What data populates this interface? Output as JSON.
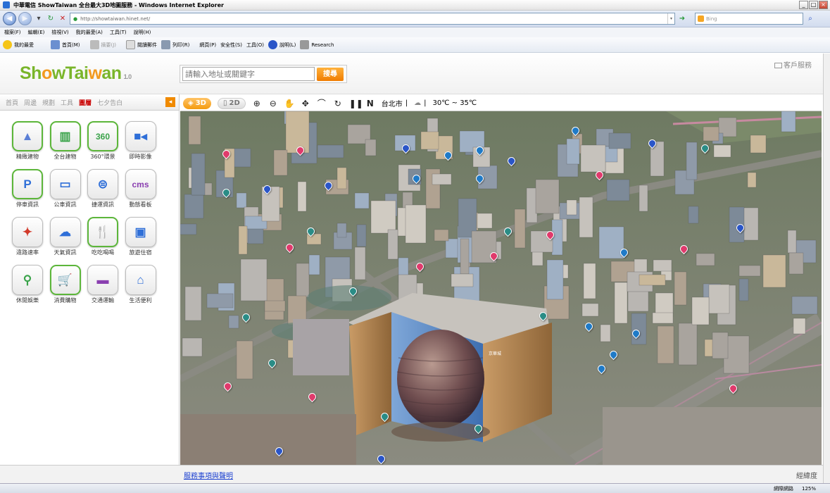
{
  "browser": {
    "title": "中華電信 ShowTaiwan 全台最大3D地圖服務 - Windows Internet Explorer",
    "url": "http://showtaiwan.hinet.net/",
    "bing_placeholder": "Bing",
    "menu": [
      "檔案(F)",
      "編輯(E)",
      "檢視(V)",
      "我的最愛(A)",
      "工具(T)",
      "說明(H)"
    ],
    "cmd": {
      "fav": "我的最愛",
      "home": "首頁(M)",
      "feed": "摘要(J)",
      "mail": "閱讀郵件",
      "print": "列印(R)",
      "page": "網頁(P)",
      "safety": "安全性(S)",
      "tools": "工具(O)",
      "help": "說明(L)",
      "research": "Research"
    },
    "status": {
      "zone": "網際網路",
      "zoom": "125%"
    }
  },
  "site": {
    "logo_a": "Sh",
    "logo_o": "o",
    "logo_b": "wTai",
    "logo_w": "w",
    "logo_c": "an",
    "version": "1.0",
    "search_placeholder": "請輸入地址或關鍵字",
    "search_button": "搜尋",
    "customer_service": "客戶服務"
  },
  "sidebar": {
    "tabs": [
      "首頁",
      "周邊",
      "規劃",
      "工具",
      "圖層",
      "七夕告白"
    ],
    "active_tab": "圖層",
    "arrow": "◂",
    "items": [
      {
        "label": "精緻建物",
        "icon": "tower-icon",
        "symbol": "▲",
        "color": "#5b7fd6",
        "highlight": true
      },
      {
        "label": "全台建物",
        "icon": "building-icon",
        "symbol": "▥",
        "color": "#3aa34a",
        "highlight": true
      },
      {
        "label": "360°環景",
        "icon": "panorama-360-icon",
        "symbol": "360",
        "color": "#3aa34a",
        "highlight": true
      },
      {
        "label": "即時影像",
        "icon": "video-camera-icon",
        "symbol": "■◂",
        "color": "#2f6fd8",
        "highlight": false
      },
      {
        "label": "停車資訊",
        "icon": "parking-icon",
        "symbol": "P",
        "color": "#2f6fd8",
        "highlight": true
      },
      {
        "label": "公車資訊",
        "icon": "bus-icon",
        "symbol": "▭",
        "color": "#2f6fd8",
        "highlight": false
      },
      {
        "label": "捷運資訊",
        "icon": "metro-icon",
        "symbol": "⊜",
        "color": "#2f6fd8",
        "highlight": false
      },
      {
        "label": "動態看板",
        "icon": "cms-board-icon",
        "symbol": "cms",
        "color": "#8a3fb0",
        "highlight": false
      },
      {
        "label": "違路速率",
        "icon": "traffic-speed-icon",
        "symbol": "✦",
        "color": "#d23a2a",
        "highlight": false
      },
      {
        "label": "天氣資訊",
        "icon": "weather-icon",
        "symbol": "☁",
        "color": "#2f6fd8",
        "highlight": false
      },
      {
        "label": "吃吃喝喝",
        "icon": "food-icon",
        "symbol": "🍴",
        "color": "#f08a00",
        "highlight": true
      },
      {
        "label": "旅遊住宿",
        "icon": "luggage-icon",
        "symbol": "▣",
        "color": "#2f6fd8",
        "highlight": false
      },
      {
        "label": "休閒娛樂",
        "icon": "bicycle-icon",
        "symbol": "⚲",
        "color": "#3aa34a",
        "highlight": false
      },
      {
        "label": "消費購物",
        "icon": "shopping-cart-icon",
        "symbol": "🛒",
        "color": "#d23a2a",
        "highlight": true
      },
      {
        "label": "交通運輸",
        "icon": "car-icon",
        "symbol": "▬",
        "color": "#8a3fb0",
        "highlight": false
      },
      {
        "label": "生活便利",
        "icon": "house-icon",
        "symbol": "⌂",
        "color": "#2f6fd8",
        "highlight": false
      }
    ]
  },
  "map": {
    "mode_3d": "3D",
    "mode_2d": "2D",
    "city": "台北市",
    "weather": "30℃ ~ 35℃",
    "building_sign": "京華城",
    "footer_link": "服務事項與聲明",
    "coord_label": "經緯度"
  }
}
